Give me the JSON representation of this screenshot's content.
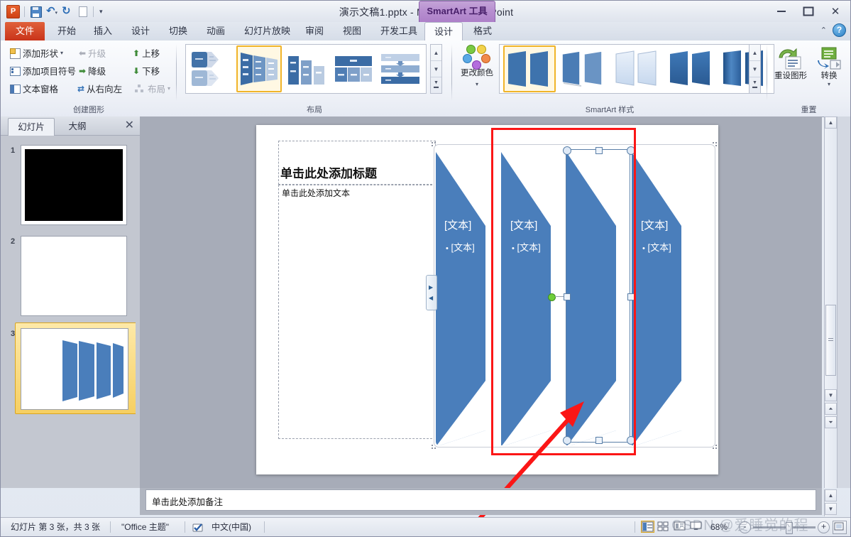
{
  "window": {
    "title": "演示文稿1.pptx  -  Microsoft PowerPoint",
    "contextual_tab": "SmartArt 工具",
    "minimize": "—",
    "maximize": "▭",
    "close": "✕",
    "help": "?",
    "collapse_ribbon": "⌃"
  },
  "quick_access": {
    "logo": "P",
    "save": "save-icon",
    "undo": "undo-icon",
    "redo": "redo-icon",
    "new": "new-doc-icon",
    "more": "▾"
  },
  "tabs": [
    {
      "label": "文件",
      "kind": "file"
    },
    {
      "label": "开始",
      "kind": "normal"
    },
    {
      "label": "插入",
      "kind": "normal"
    },
    {
      "label": "设计",
      "kind": "normal"
    },
    {
      "label": "切换",
      "kind": "normal"
    },
    {
      "label": "动画",
      "kind": "normal"
    },
    {
      "label": "幻灯片放映",
      "kind": "normal"
    },
    {
      "label": "审阅",
      "kind": "normal"
    },
    {
      "label": "视图",
      "kind": "normal"
    },
    {
      "label": "开发工具",
      "kind": "normal"
    },
    {
      "label": "设计",
      "kind": "active"
    },
    {
      "label": "格式",
      "kind": "normal"
    }
  ],
  "ribbon": {
    "groups": [
      {
        "name": "创建图形",
        "label": "创建图形"
      },
      {
        "name": "布局",
        "label": "布局"
      },
      {
        "name": "SmartArt 样式",
        "label": "SmartArt 样式"
      },
      {
        "name": "重置",
        "label": "重置"
      }
    ],
    "create_graphic": {
      "add_shape": "添加形状",
      "add_bullet": "添加项目符号",
      "text_pane": "文本窗格",
      "promote": "升级",
      "demote": "降级",
      "right_to_left": "从右向左",
      "move_up": "上移",
      "move_down": "下移",
      "layout": "布局",
      "dropdown_caret": "▾"
    },
    "layout_gallery": {
      "items": [
        "layout-process-arrows",
        "layout-vertical-bending",
        "layout-ascending-blocks",
        "layout-grouped-list",
        "layout-staged-process"
      ],
      "selected_index": 1,
      "scroll_up": "▲",
      "scroll_down": "▼",
      "more": "▼"
    },
    "smartart_styles": {
      "change_colors": "更改颜色",
      "items": [
        "style-simple-fill",
        "style-white-outline",
        "style-subtle-effect",
        "style-moderate-effect",
        "style-intense-effect"
      ],
      "selected_index": 0,
      "scroll_up": "▲",
      "scroll_down": "▼",
      "more": "▼"
    },
    "reset": {
      "reset_graphic": "重设图形",
      "convert": "转换",
      "convert_caret": "▾"
    }
  },
  "slide_pane": {
    "tab_slides": "幻灯片",
    "tab_outline": "大纲",
    "close": "✕",
    "thumbnails": [
      {
        "number": "1",
        "kind": "black"
      },
      {
        "number": "2",
        "kind": "blank"
      },
      {
        "number": "3",
        "kind": "smartart",
        "selected": true
      }
    ]
  },
  "slide": {
    "title_placeholder": "单击此处添加标题",
    "body_placeholder": "单击此处添加文本",
    "smartart": {
      "shapes": [
        {
          "label": "[文本]",
          "sub": "[文本]",
          "has_text": true
        },
        {
          "label": "[文本]",
          "sub": "[文本]",
          "has_text": true
        },
        {
          "label": "",
          "sub": "",
          "has_text": false,
          "selected": true
        },
        {
          "label": "[文本]",
          "sub": "[文本]",
          "has_text": true
        }
      ],
      "fill_color": "#4a7ebb",
      "text_pane_toggle": "text-pane-toggle"
    }
  },
  "notes": {
    "placeholder": "单击此处添加备注"
  },
  "status_bar": {
    "slide_count": "幻灯片 第 3 张，共 3 张",
    "theme": "\"Office 主题\"",
    "language": "中文(中国)",
    "spellcheck_icon": "spellcheck-icon",
    "views": [
      "normal-view",
      "slide-sorter-view",
      "reading-view",
      "slideshow-view"
    ],
    "selected_view_index": 0,
    "zoom_level": "68%",
    "zoom_out": "-",
    "zoom_in": "+",
    "fit_to_window": "fit-icon"
  },
  "annotation": {
    "red_box": "red-highlight-box",
    "red_arrow": "red-pointer-arrow"
  },
  "watermark": "CSDN @爱睡觉的程"
}
